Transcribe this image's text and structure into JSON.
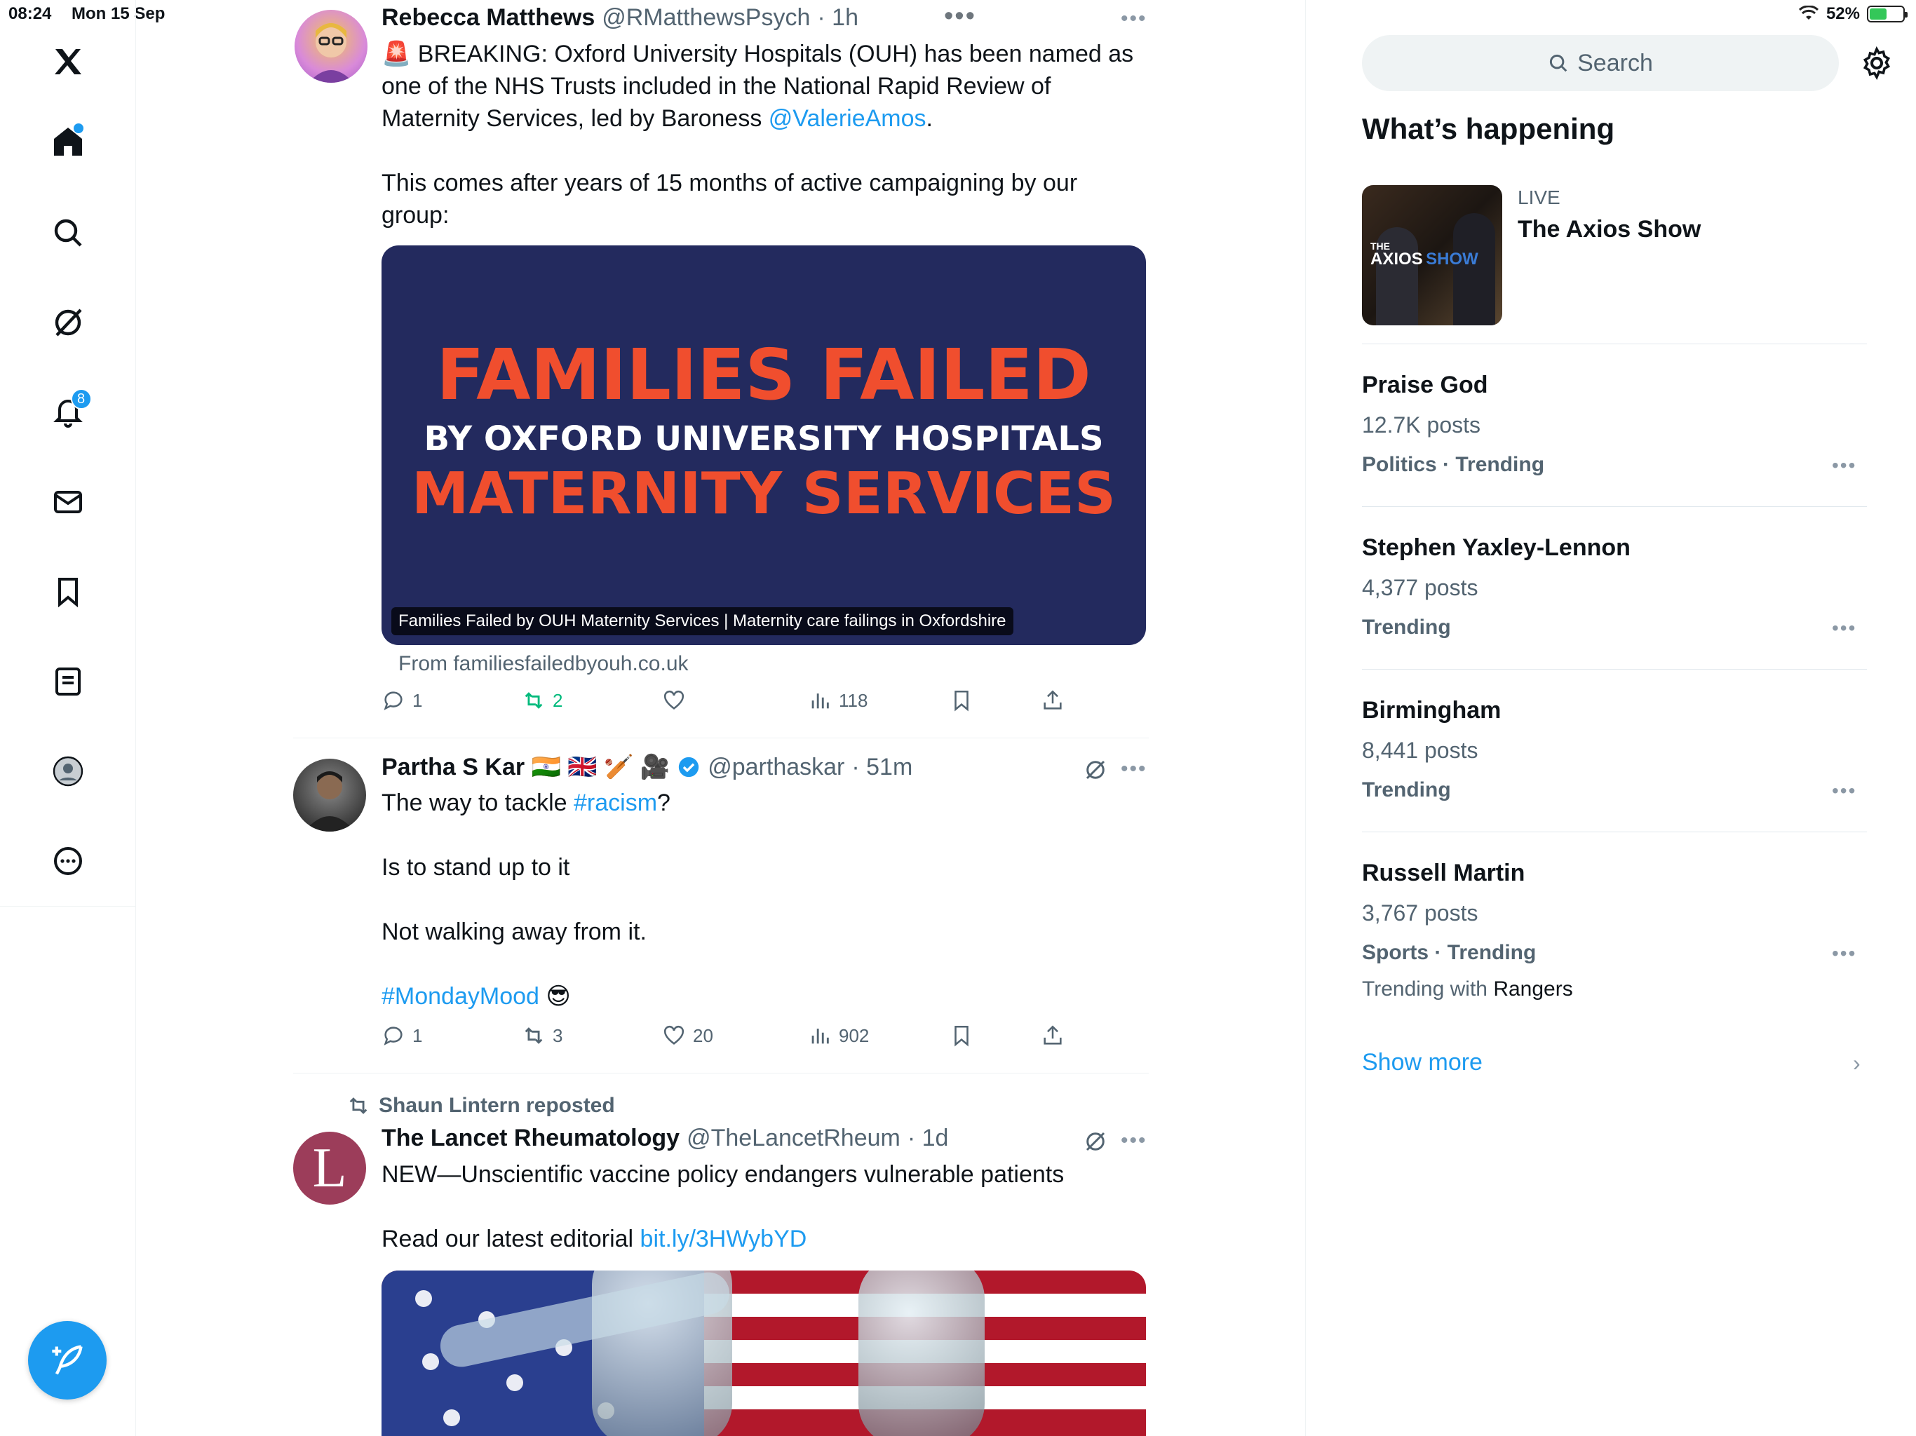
{
  "status_bar": {
    "time": "08:24",
    "date": "Mon 15 Sep",
    "battery": "52%"
  },
  "nav": {
    "notifications_badge": "8",
    "items": [
      "home",
      "explore",
      "grok",
      "notifications",
      "messages",
      "bookmarks",
      "lists",
      "profile",
      "more"
    ]
  },
  "feed": {
    "tweet1": {
      "name": "Rebecca Matthews",
      "handle": "@RMatthewsPsych",
      "time": "· 1h",
      "text_part1": "🚨 BREAKING: Oxford University Hospitals (OUH) has been named as\none of the NHS Trusts included in the National Rapid Review of\nMaternity Services, led by Baroness ",
      "mention": "@ValerieAmos",
      "text_part2": ".\n\nThis comes after years of 15 months of active campaigning by our\ngroup:",
      "card_line1": "FAMILIES FAILED",
      "card_line2": "BY OXFORD UNIVERSITY HOSPITALS",
      "card_line3": "MATERNITY SERVICES",
      "card_caption": "Families Failed by OUH Maternity Services | Maternity care failings in Oxfordshire",
      "card_from": "From familiesfailedbyouh.co.uk",
      "replies": "1",
      "reposts": "2",
      "likes": "",
      "views": "118"
    },
    "tweet2": {
      "name": "Partha S Kar 🇮🇳 🇬🇧 🏏 🎥",
      "handle": "@parthaskar",
      "time": "· 51m",
      "text_part1": "The way to tackle ",
      "hashtag1": "#racism",
      "text_part2": "?\n\nIs to stand up to it\n\nNot walking away from it.\n\n",
      "hashtag2": "#MondayMood",
      "emoji": " 😎",
      "replies": "1",
      "reposts": "3",
      "likes": "20",
      "views": "902"
    },
    "tweet3": {
      "repost_by": "Shaun Lintern reposted",
      "avatar_letter": "L",
      "name": "The Lancet Rheumatology",
      "handle": "@TheLancetRheum",
      "time": "· 1d",
      "text_line1": "NEW—Unscientific vaccine policy endangers vulnerable patients",
      "text_line2": "Read our latest editorial ",
      "link": "bit.ly/3HWybYD"
    }
  },
  "sidebar": {
    "search_placeholder": "Search",
    "whats_happening": "What’s happening",
    "live": {
      "label": "LIVE",
      "title": "The Axios Show",
      "thumb_text_1": "THE",
      "thumb_text_2": "AXIOS",
      "thumb_text_3": "SHOW"
    },
    "trends": [
      {
        "name": "Praise God",
        "posts": "12.7K posts",
        "category": "Politics · Trending"
      },
      {
        "name": "Stephen Yaxley-Lennon",
        "posts": "4,377 posts",
        "category": "Trending"
      },
      {
        "name": "Birmingham",
        "posts": "8,441 posts",
        "category": "Trending"
      },
      {
        "name": "Russell Martin",
        "posts": "3,767 posts",
        "category": "Sports · Trending",
        "with_prefix": "Trending with ",
        "with_name": "Rangers"
      }
    ],
    "show_more": "Show more"
  },
  "colors": {
    "accent": "#1d9bf0",
    "repost_green": "#00ba7c",
    "card_bg": "#232a5e",
    "card_red": "#f04e2e"
  }
}
